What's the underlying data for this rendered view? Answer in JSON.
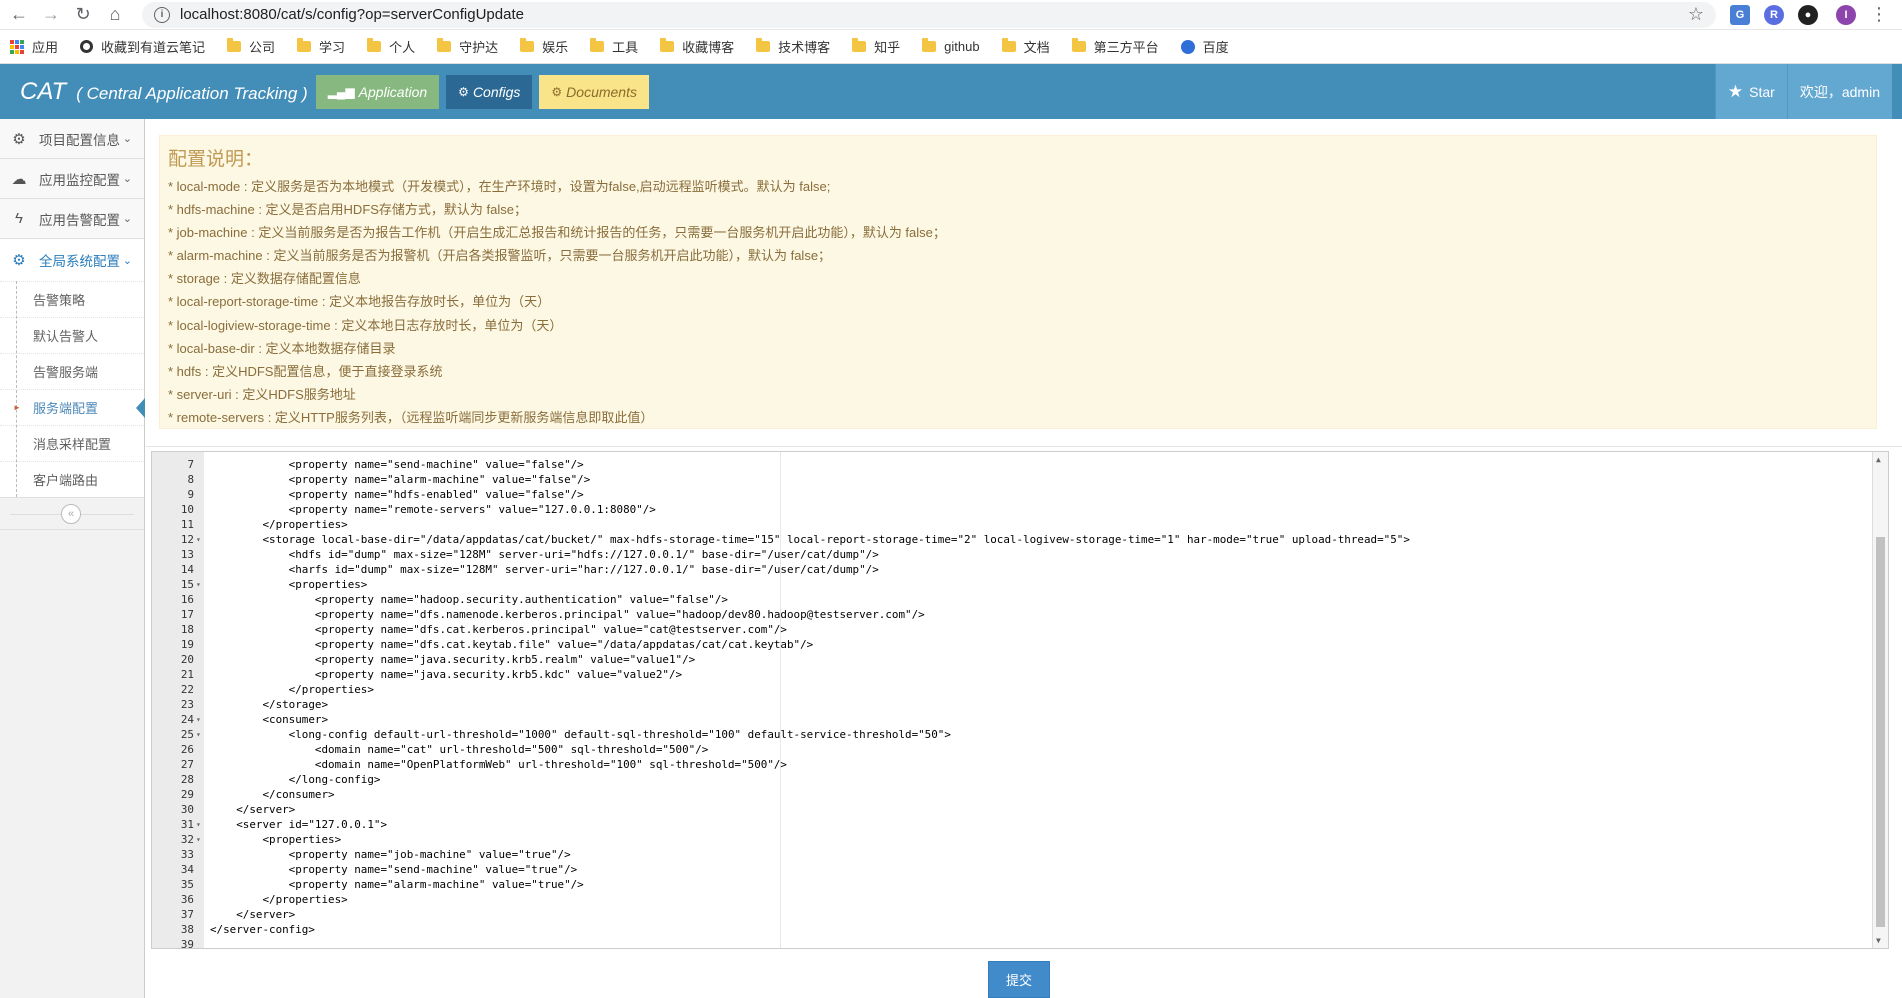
{
  "browser": {
    "url": "localhost:8080/cat/s/config?op=serverConfigUpdate",
    "bookmarks": [
      {
        "label": "应用",
        "icon": "apps-icon"
      },
      {
        "label": "收藏到有道云笔记",
        "icon": "youdao-icon"
      },
      {
        "label": "公司",
        "icon": "folder-icon"
      },
      {
        "label": "学习",
        "icon": "folder-icon"
      },
      {
        "label": "个人",
        "icon": "folder-icon"
      },
      {
        "label": "守护达",
        "icon": "folder-icon"
      },
      {
        "label": "娱乐",
        "icon": "folder-icon"
      },
      {
        "label": "工具",
        "icon": "folder-icon"
      },
      {
        "label": "收藏博客",
        "icon": "folder-icon"
      },
      {
        "label": "技术博客",
        "icon": "folder-icon"
      },
      {
        "label": "知乎",
        "icon": "folder-icon"
      },
      {
        "label": "github",
        "icon": "folder-icon"
      },
      {
        "label": "文档",
        "icon": "folder-icon"
      },
      {
        "label": "第三方平台",
        "icon": "folder-icon"
      },
      {
        "label": "百度",
        "icon": "baidu-icon"
      }
    ],
    "profile_initial": "I"
  },
  "header": {
    "brand": "CAT",
    "brand_sub": "( Central Application Tracking )",
    "buttons": {
      "application": "Application",
      "configs": "Configs",
      "documents": "Documents"
    },
    "star_label": "Star",
    "welcome": "欢迎，admin"
  },
  "sidebar": {
    "items": [
      {
        "label": "项目配置信息",
        "icon": "gears-icon"
      },
      {
        "label": "应用监控配置",
        "icon": "cloud-icon"
      },
      {
        "label": "应用告警配置",
        "icon": "bolt-icon"
      },
      {
        "label": "全局系统配置",
        "icon": "gear-icon"
      }
    ],
    "subitems": [
      "告警策略",
      "默认告警人",
      "告警服务端",
      "服务端配置",
      "消息采样配置",
      "客户端路由"
    ],
    "active_subitem": "服务端配置"
  },
  "notes": {
    "title": "配置说明：",
    "lines": [
      "* local-mode : 定义服务是否为本地模式（开发模式），在生产环境时，设置为false,启动远程监听模式。默认为 false;",
      "* hdfs-machine : 定义是否启用HDFS存储方式，默认为 false；",
      "* job-machine : 定义当前服务是否为报告工作机（开启生成汇总报告和统计报告的任务，只需要一台服务机开启此功能），默认为 false；",
      "* alarm-machine : 定义当前服务是否为报警机（开启各类报警监听，只需要一台服务机开启此功能），默认为 false；",
      "* storage : 定义数据存储配置信息",
      "* local-report-storage-time : 定义本地报告存放时长，单位为（天）",
      "* local-logiview-storage-time : 定义本地日志存放时长，单位为（天）",
      "* local-base-dir : 定义本地数据存储目录",
      "* hdfs : 定义HDFS配置信息，便于直接登录系统",
      "* server-uri : 定义HDFS服务地址",
      "* remote-servers : 定义HTTP服务列表，（远程监听端同步更新服务端信息即取此值）"
    ]
  },
  "editor": {
    "lines": [
      {
        "n": "7",
        "fold": "",
        "code": "            <property name=\"send-machine\" value=\"false\"/>"
      },
      {
        "n": "8",
        "fold": "",
        "code": "            <property name=\"alarm-machine\" value=\"false\"/>"
      },
      {
        "n": "9",
        "fold": "",
        "code": "            <property name=\"hdfs-enabled\" value=\"false\"/>"
      },
      {
        "n": "10",
        "fold": "",
        "code": "            <property name=\"remote-servers\" value=\"127.0.0.1:8080\"/>"
      },
      {
        "n": "11",
        "fold": "",
        "code": "        </properties>"
      },
      {
        "n": "12",
        "fold": "▾",
        "code": "        <storage local-base-dir=\"/data/appdatas/cat/bucket/\" max-hdfs-storage-time=\"15\" local-report-storage-time=\"2\" local-logivew-storage-time=\"1\" har-mode=\"true\" upload-thread=\"5\">"
      },
      {
        "n": "13",
        "fold": "",
        "code": "            <hdfs id=\"dump\" max-size=\"128M\" server-uri=\"hdfs://127.0.0.1/\" base-dir=\"/user/cat/dump\"/>"
      },
      {
        "n": "14",
        "fold": "",
        "code": "            <harfs id=\"dump\" max-size=\"128M\" server-uri=\"har://127.0.0.1/\" base-dir=\"/user/cat/dump\"/>"
      },
      {
        "n": "15",
        "fold": "▾",
        "code": "            <properties>"
      },
      {
        "n": "16",
        "fold": "",
        "code": "                <property name=\"hadoop.security.authentication\" value=\"false\"/>"
      },
      {
        "n": "17",
        "fold": "",
        "code": "                <property name=\"dfs.namenode.kerberos.principal\" value=\"hadoop/dev80.hadoop@testserver.com\"/>"
      },
      {
        "n": "18",
        "fold": "",
        "code": "                <property name=\"dfs.cat.kerberos.principal\" value=\"cat@testserver.com\"/>"
      },
      {
        "n": "19",
        "fold": "",
        "code": "                <property name=\"dfs.cat.keytab.file\" value=\"/data/appdatas/cat/cat.keytab\"/>"
      },
      {
        "n": "20",
        "fold": "",
        "code": "                <property name=\"java.security.krb5.realm\" value=\"value1\"/>"
      },
      {
        "n": "21",
        "fold": "",
        "code": "                <property name=\"java.security.krb5.kdc\" value=\"value2\"/>"
      },
      {
        "n": "22",
        "fold": "",
        "code": "            </properties>"
      },
      {
        "n": "23",
        "fold": "",
        "code": "        </storage>"
      },
      {
        "n": "24",
        "fold": "▾",
        "code": "        <consumer>"
      },
      {
        "n": "25",
        "fold": "▾",
        "code": "            <long-config default-url-threshold=\"1000\" default-sql-threshold=\"100\" default-service-threshold=\"50\">"
      },
      {
        "n": "26",
        "fold": "",
        "code": "                <domain name=\"cat\" url-threshold=\"500\" sql-threshold=\"500\"/>"
      },
      {
        "n": "27",
        "fold": "",
        "code": "                <domain name=\"OpenPlatformWeb\" url-threshold=\"100\" sql-threshold=\"500\"/>"
      },
      {
        "n": "28",
        "fold": "",
        "code": "            </long-config>"
      },
      {
        "n": "29",
        "fold": "",
        "code": "        </consumer>"
      },
      {
        "n": "30",
        "fold": "",
        "code": "    </server>"
      },
      {
        "n": "31",
        "fold": "▾",
        "code": "    <server id=\"127.0.0.1\">"
      },
      {
        "n": "32",
        "fold": "▾",
        "code": "        <properties>"
      },
      {
        "n": "33",
        "fold": "",
        "code": "            <property name=\"job-machine\" value=\"true\"/>"
      },
      {
        "n": "34",
        "fold": "",
        "code": "            <property name=\"send-machine\" value=\"true\"/>"
      },
      {
        "n": "35",
        "fold": "",
        "code": "            <property name=\"alarm-machine\" value=\"true\"/>"
      },
      {
        "n": "36",
        "fold": "",
        "code": "        </properties>"
      },
      {
        "n": "37",
        "fold": "",
        "code": "    </server>"
      },
      {
        "n": "38",
        "fold": "",
        "code": "</server-config>"
      },
      {
        "n": "39",
        "fold": "",
        "code": ""
      }
    ]
  },
  "submit_label": "提交",
  "colors": {
    "header_bg": "#438eb9",
    "application_btn": "#87b87f",
    "configs_btn": "#2b6893",
    "documents_btn": "#f9e489",
    "note_bg": "#fcf8e3",
    "note_text": "#8a6d3b",
    "submit_btn": "#428bca"
  }
}
